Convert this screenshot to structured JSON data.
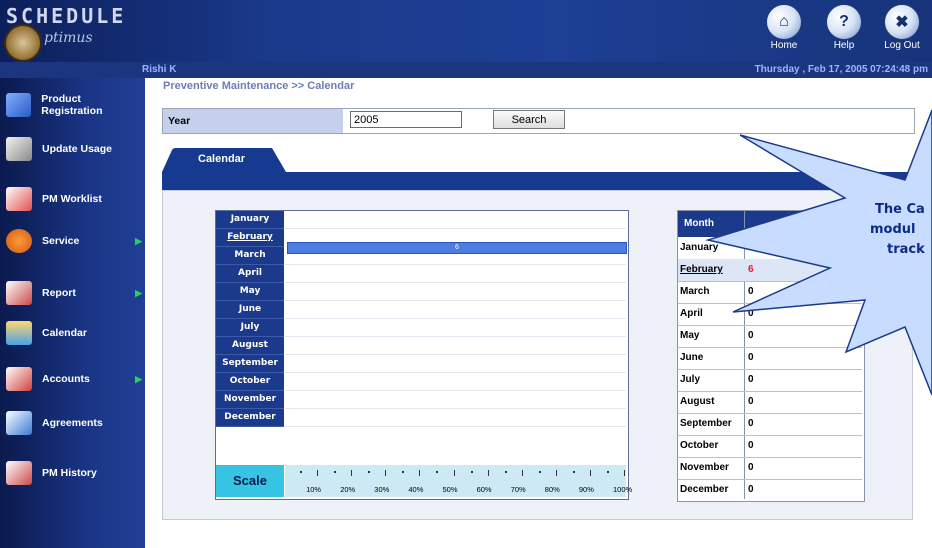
{
  "logo": {
    "title": "SCHEDULE",
    "subtitle": "ptimus"
  },
  "header": {
    "buttons": [
      {
        "label": "Home",
        "icon": "home-icon",
        "glyph": "⌂"
      },
      {
        "label": "Help",
        "icon": "help-icon",
        "glyph": "?"
      },
      {
        "label": "Log Out",
        "icon": "logout-icon",
        "glyph": "✖"
      }
    ],
    "user": "Rishi K",
    "datetime": "Thursday , Feb 17, 2005 07:24:48 pm"
  },
  "sidebar": {
    "items": [
      {
        "label": "Product Registration",
        "icon": "product-registration-icon",
        "submenu": false
      },
      {
        "label": "Update Usage",
        "icon": "update-usage-icon",
        "submenu": false
      },
      {
        "label": "PM Worklist",
        "icon": "pm-worklist-icon",
        "submenu": false
      },
      {
        "label": "Service",
        "icon": "service-icon",
        "submenu": true
      },
      {
        "label": "Report",
        "icon": "report-icon",
        "submenu": true
      },
      {
        "label": "Calendar",
        "icon": "calendar-icon",
        "submenu": false
      },
      {
        "label": "Accounts",
        "icon": "accounts-icon",
        "submenu": true
      },
      {
        "label": "Agreements",
        "icon": "agreements-icon",
        "submenu": false
      },
      {
        "label": "PM History",
        "icon": "pm-history-icon",
        "submenu": false
      }
    ]
  },
  "breadcrumb": "Preventive Maintenance >> Calendar",
  "search": {
    "year_label": "Year",
    "year_value": "2005",
    "button_label": "Search"
  },
  "tab": {
    "label": "Calendar"
  },
  "grid": {
    "months": [
      "January",
      "February",
      "March",
      "April",
      "May",
      "June",
      "July",
      "August",
      "September",
      "October",
      "November",
      "December"
    ],
    "february_bar_value": "6",
    "scale_label": "Scale",
    "scale_ticks": [
      "10%",
      "20%",
      "30%",
      "40%",
      "50%",
      "60%",
      "70%",
      "80%",
      "90%",
      "100%"
    ]
  },
  "table": {
    "header_month": "Month",
    "rows": [
      {
        "month": "January",
        "count": "0"
      },
      {
        "month": "February",
        "count": "6"
      },
      {
        "month": "March",
        "count": "0"
      },
      {
        "month": "April",
        "count": "0"
      },
      {
        "month": "May",
        "count": "0"
      },
      {
        "month": "June",
        "count": "0"
      },
      {
        "month": "July",
        "count": "0"
      },
      {
        "month": "August",
        "count": "0"
      },
      {
        "month": "September",
        "count": "0"
      },
      {
        "month": "October",
        "count": "0"
      },
      {
        "month": "November",
        "count": "0"
      },
      {
        "month": "December",
        "count": "0"
      }
    ]
  },
  "callout": {
    "line1": "The Ca",
    "line2": "modul",
    "line3": "track"
  },
  "colors": {
    "navy": "#1b3a8c",
    "highlight_red": "#e02020",
    "callout_fill": "#c8dcff"
  }
}
